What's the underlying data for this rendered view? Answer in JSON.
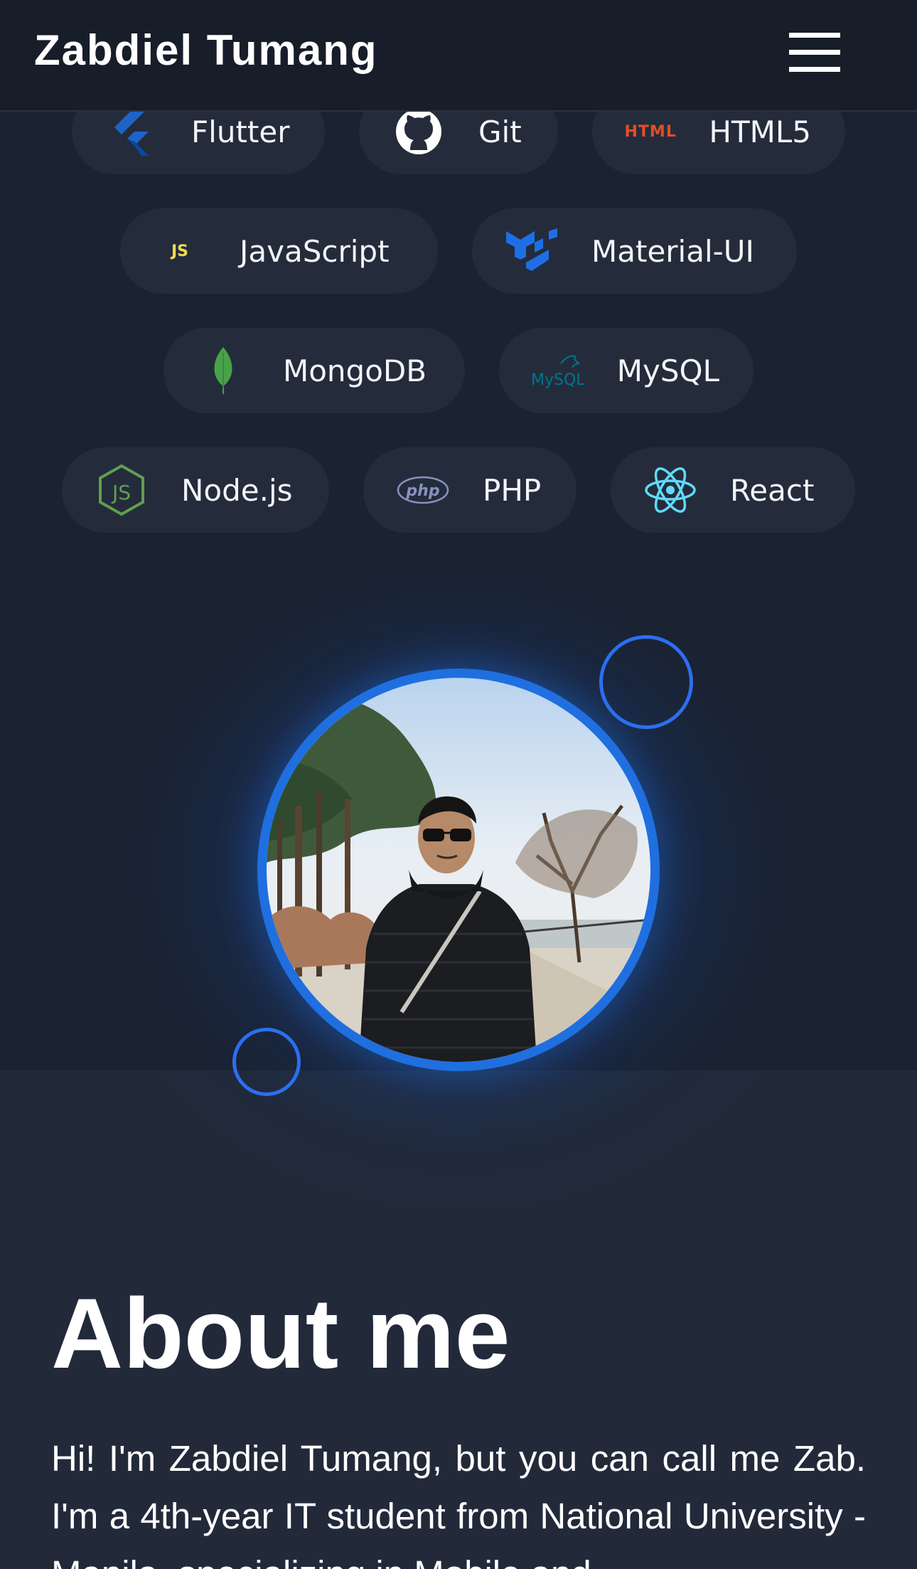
{
  "header": {
    "title": "Zabdiel Tumang",
    "menu_icon": "hamburger-menu-icon"
  },
  "skills": [
    {
      "label": "Flutter",
      "icon": "flutter-icon",
      "color": "#1e64c8"
    },
    {
      "label": "Git",
      "icon": "github-icon",
      "color": "#ffffff"
    },
    {
      "label": "HTML5",
      "icon": "html5-icon",
      "color": "#e44d26",
      "icon_text": "HTML"
    },
    {
      "label": "JavaScript",
      "icon": "javascript-icon",
      "color": "#f0db4f",
      "icon_text": "JS"
    },
    {
      "label": "Material-UI",
      "icon": "material-ui-icon",
      "color": "#1e6fe6"
    },
    {
      "label": "MongoDB",
      "icon": "mongodb-leaf-icon",
      "color": "#47a248"
    },
    {
      "label": "MySQL",
      "icon": "mysql-dolphin-icon",
      "color": "#00758f",
      "icon_text": "MySQL"
    },
    {
      "label": "Node.js",
      "icon": "nodejs-hexagon-icon",
      "color": "#5fa04e",
      "icon_text": "JS"
    },
    {
      "label": "PHP",
      "icon": "php-icon",
      "color": "#8892bf",
      "icon_text": "php"
    },
    {
      "label": "React",
      "icon": "react-atom-icon",
      "color": "#61dafb"
    }
  ],
  "hero": {
    "avatar": "profile-photo",
    "accent": "#1f6fe0"
  },
  "about": {
    "title": "About me",
    "text": "Hi! I'm Zabdiel Tumang, but you can call me Zab. I'm a 4th-year IT student from National University - Manila, specializing in Mobile and"
  }
}
